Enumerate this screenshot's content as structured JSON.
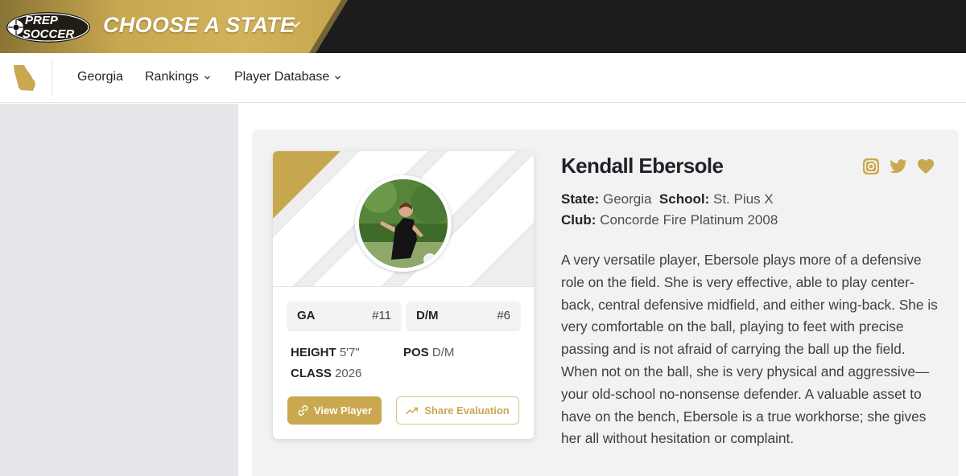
{
  "header": {
    "logo_line1": "PREP",
    "logo_line2": "SOCCER",
    "choose_state": "CHOOSE A STATE",
    "colors": {
      "gold": "#c9a84f",
      "dark": "#1c1c1e"
    }
  },
  "nav": {
    "state_icon": "georgia-state-icon",
    "items": [
      {
        "label": "Georgia",
        "has_dropdown": false
      },
      {
        "label": "Rankings",
        "has_dropdown": true
      },
      {
        "label": "Player Database",
        "has_dropdown": true
      }
    ]
  },
  "player": {
    "name": "Kendall Ebersole",
    "state_label": "State:",
    "state": "Georgia",
    "school_label": "School:",
    "school": "St. Pius X",
    "club_label": "Club:",
    "club": "Concorde Fire Platinum 2008",
    "bio": "A very versatile player, Ebersole plays more of a defensive role on the field. She is very effective, able to play center-back, central defensive midfield, and either wing-back. She is very comfortable on the ball, playing to feet with precise passing and is not afraid of carrying the ball up the field. When not on the ball, she is very physical and aggressive—your old-school no-nonsense defender. A valuable asset to have on the bench, Ebersole is a true workhorse; she gives her all without hesitation or complaint.",
    "social_icons": [
      "instagram-icon",
      "twitter-icon",
      "heart-icon"
    ]
  },
  "card": {
    "chips": [
      {
        "label": "GA",
        "value": "#11"
      },
      {
        "label": "D/M",
        "value": "#6"
      }
    ],
    "height_label": "HEIGHT",
    "height": "5'7\"",
    "pos_label": "POS",
    "pos": "D/M",
    "class_label": "CLASS",
    "class": "2026",
    "view_button": "View Player",
    "share_button": "Share Evaluation"
  }
}
